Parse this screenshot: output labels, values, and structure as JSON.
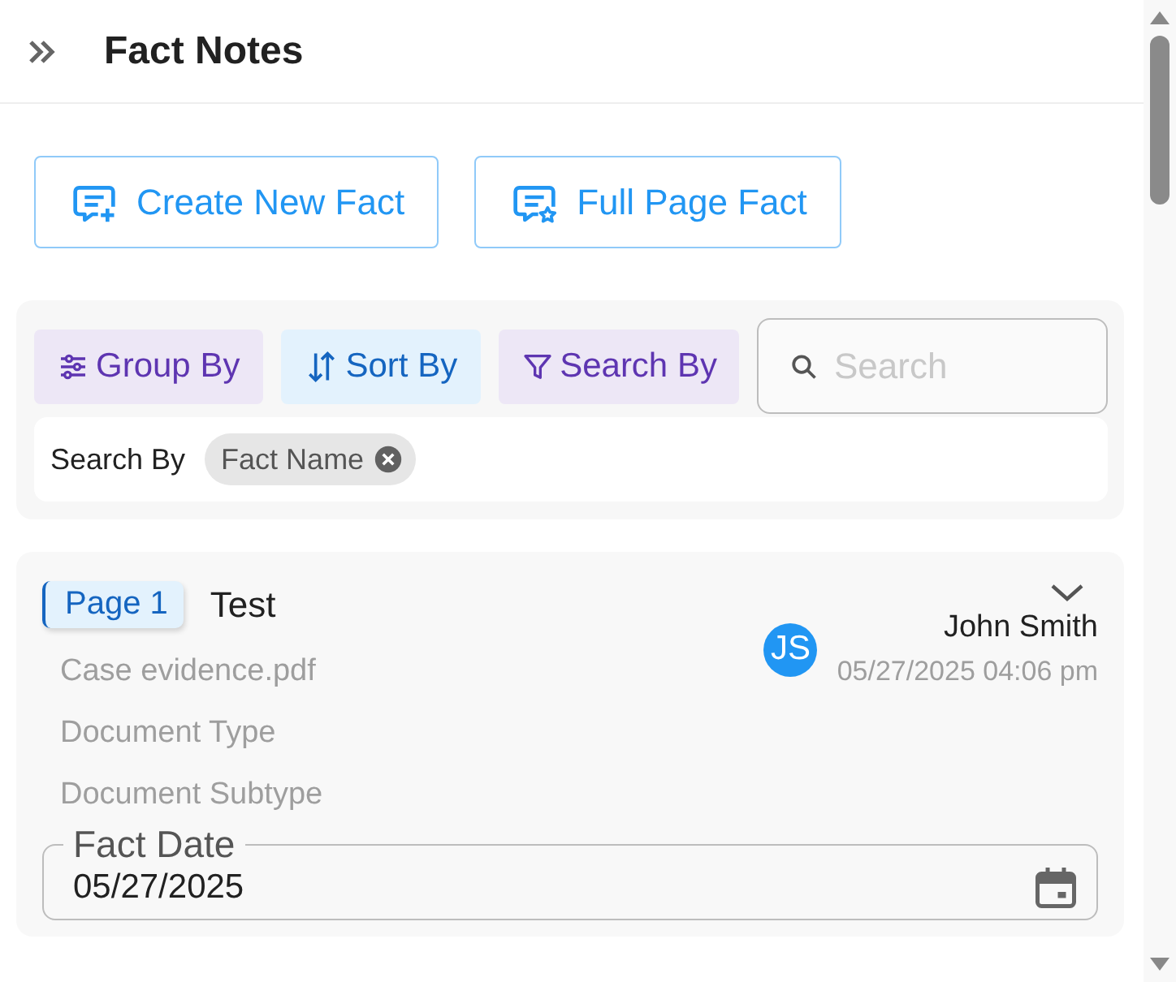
{
  "header": {
    "title": "Fact Notes"
  },
  "actions": [
    {
      "label": "Create New Fact",
      "kind": "create"
    },
    {
      "label": "Full Page Fact",
      "kind": "fullpage"
    }
  ],
  "toolbar": {
    "buttons": [
      {
        "label": "Group By",
        "kind": "group"
      },
      {
        "label": "Sort By",
        "kind": "sort"
      },
      {
        "label": "Search By",
        "kind": "filter"
      }
    ],
    "search": {
      "placeholder": "Search"
    },
    "search_by": {
      "label": "Search By",
      "chips": [
        "Fact Name"
      ]
    }
  },
  "fact": {
    "page": "Page 1",
    "title": "Test",
    "file": "Case evidence.pdf",
    "document_type": "Document Type",
    "document_subtype": "Document Subtype",
    "author": {
      "initials": "JS",
      "name": "John Smith",
      "timestamp": "05/27/2025 04:06 pm"
    },
    "fact_date": {
      "label": "Fact Date",
      "value": "05/27/2025"
    }
  }
}
